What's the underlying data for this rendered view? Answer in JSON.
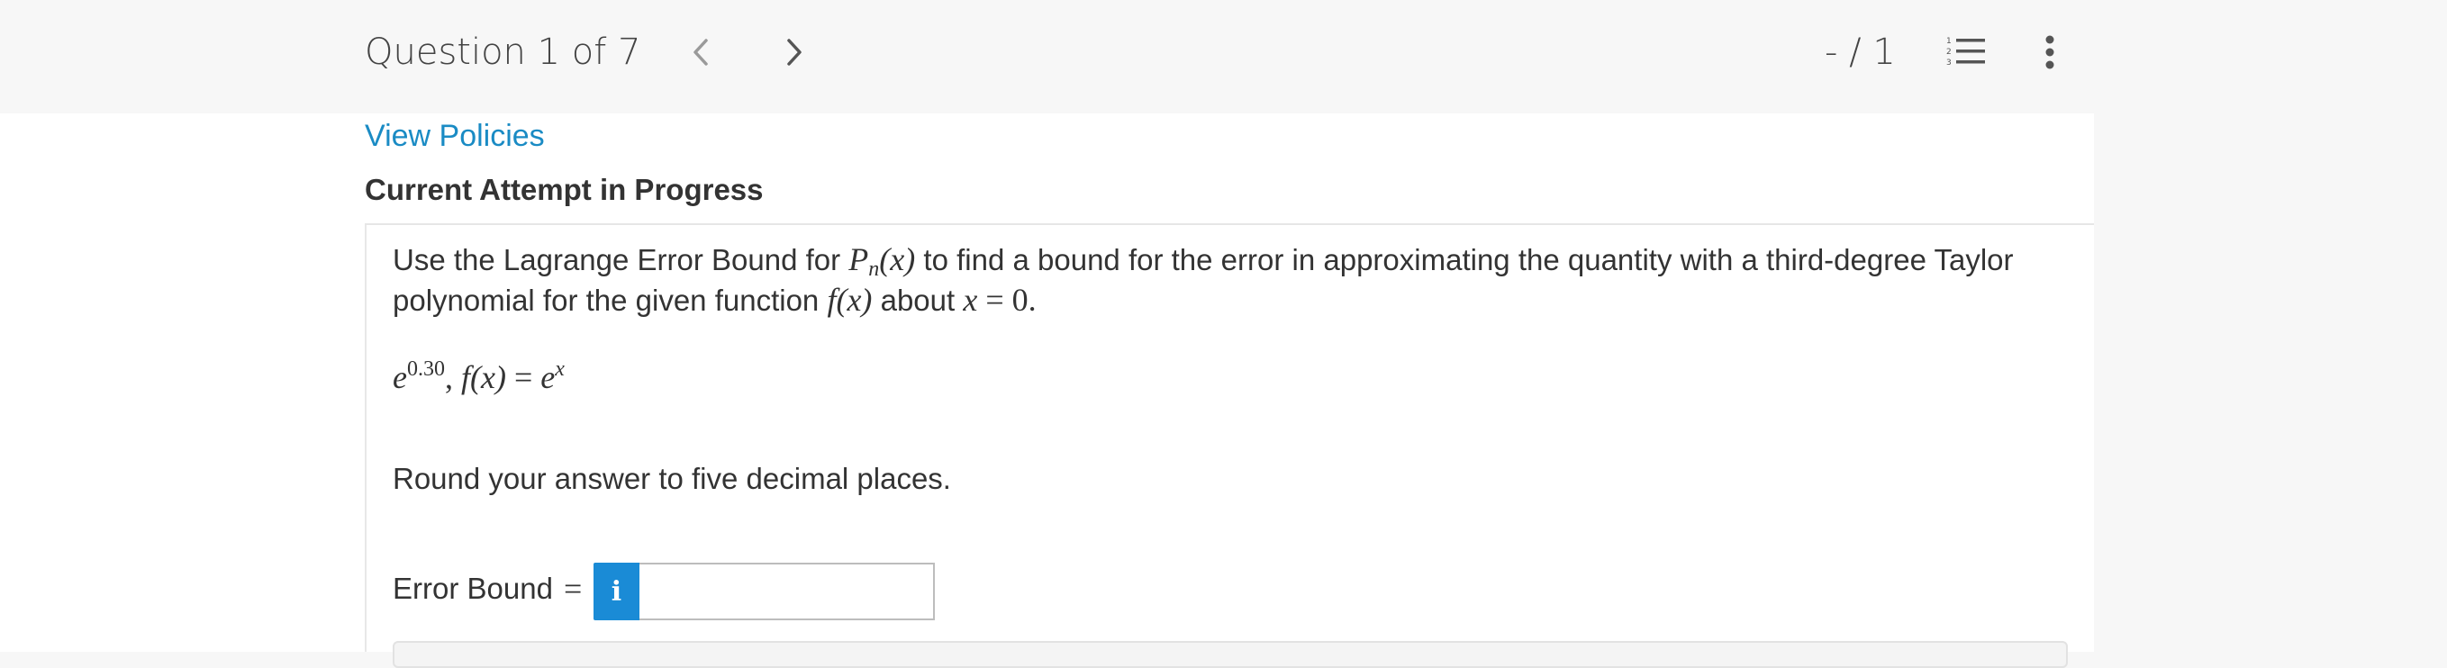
{
  "header": {
    "question_counter": "Question 1 of 7",
    "score": "- / 1",
    "icons": {
      "prev": "chevron-left-icon",
      "next": "chevron-right-icon",
      "list": "numbered-list-icon",
      "more": "vertical-dots-icon"
    }
  },
  "links": {
    "view_policies": "View Policies"
  },
  "attempt_status": "Current Attempt in Progress",
  "question": {
    "prompt_part1": "Use the Lagrange Error Bound for ",
    "pn_symbol": "P",
    "pn_subscript": "n",
    "pn_arg": "(x)",
    "prompt_part2": " to find a bound for the error in approximating the quantity with a third-degree Taylor polynomial for the given function ",
    "func": "f",
    "func_arg": "(x)",
    "prompt_part3": " about ",
    "about_var": "x",
    "about_eq": " = 0.",
    "expr_base": "e",
    "expr_exp": "0.30",
    "expr_sep": ", ",
    "expr_func": "f",
    "expr_func_arg": "(x)",
    "expr_eq": " = ",
    "expr_rhs_base": "e",
    "expr_rhs_exp": "x",
    "round_note": "Round your answer to five decimal places."
  },
  "answer": {
    "label": "Error Bound",
    "equals": "=",
    "info_glyph": "i",
    "value": "",
    "placeholder": ""
  },
  "colors": {
    "link": "#1a8bc4",
    "info_button": "#1a8bd6",
    "header_bg": "#f7f7f7"
  }
}
